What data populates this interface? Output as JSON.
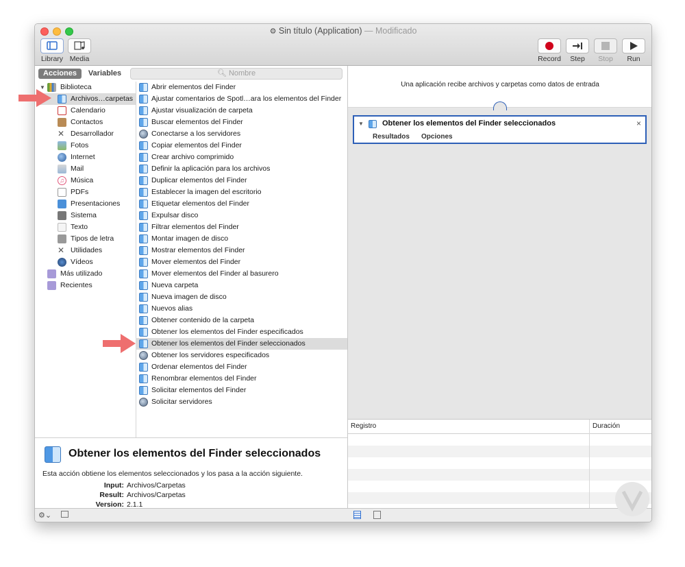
{
  "window": {
    "title": "Sin título (Application)",
    "title_suffix": "— Modificado"
  },
  "toolbar": {
    "library_label": "Library",
    "media_label": "Media",
    "record_label": "Record",
    "step_label": "Step",
    "stop_label": "Stop",
    "run_label": "Run"
  },
  "left": {
    "tab_actions": "Acciones",
    "tab_variables": "Variables",
    "search_placeholder": "Nombre",
    "library": [
      {
        "label": "Biblioteca",
        "icon": "library-icon"
      },
      {
        "label": "Archivos…carpetas",
        "icon": "finder-icon"
      },
      {
        "label": "Calendario",
        "icon": "calendar-icon"
      },
      {
        "label": "Contactos",
        "icon": "contacts-icon"
      },
      {
        "label": "Desarrollador",
        "icon": "developer-icon"
      },
      {
        "label": "Fotos",
        "icon": "photos-icon"
      },
      {
        "label": "Internet",
        "icon": "internet-icon"
      },
      {
        "label": "Mail",
        "icon": "mail-icon"
      },
      {
        "label": "Música",
        "icon": "music-icon"
      },
      {
        "label": "PDFs",
        "icon": "pdf-icon"
      },
      {
        "label": "Presentaciones",
        "icon": "presentation-icon"
      },
      {
        "label": "Sistema",
        "icon": "system-icon"
      },
      {
        "label": "Texto",
        "icon": "text-icon"
      },
      {
        "label": "Tipos de letra",
        "icon": "fonts-icon"
      },
      {
        "label": "Utilidades",
        "icon": "utilities-icon"
      },
      {
        "label": "Vídeos",
        "icon": "videos-icon"
      },
      {
        "label": "Más utilizado",
        "icon": "smart-folder-icon"
      },
      {
        "label": "Recientes",
        "icon": "smart-folder-icon"
      }
    ],
    "actions": [
      "Abrir elementos del Finder",
      "Ajustar comentarios de Spotl…ara los elementos del Finder",
      "Ajustar visualización de carpeta",
      "Buscar elementos del Finder",
      "Conectarse a los servidores",
      "Copiar elementos del Finder",
      "Crear archivo comprimido",
      "Definir la aplicación para los archivos",
      "Duplicar elementos del Finder",
      "Establecer la imagen del escritorio",
      "Etiquetar elementos del Finder",
      "Expulsar disco",
      "Filtrar elementos del Finder",
      "Montar imagen de disco",
      "Mostrar elementos del Finder",
      "Mover elementos del Finder",
      "Mover elementos del Finder al basurero",
      "Nueva carpeta",
      "Nueva imagen de disco",
      "Nuevos alias",
      "Obtener contenido de la carpeta",
      "Obtener los elementos del Finder especificados",
      "Obtener los elementos del Finder seleccionados",
      "Obtener los servidores especificados",
      "Ordenar elementos del Finder",
      "Renombrar elementos del Finder",
      "Solicitar elementos del Finder",
      "Solicitar servidores"
    ],
    "description": {
      "title": "Obtener los elementos del Finder seleccionados",
      "text": "Esta acción obtiene los elementos seleccionados y los pasa a la acción siguiente.",
      "input_key": "Input:",
      "input_val": "Archivos/Carpetas",
      "result_key": "Result:",
      "result_val": "Archivos/Carpetas",
      "version_key": "Version:",
      "version_val": "2.1.1"
    }
  },
  "workflow": {
    "input_text": "Una aplicación recibe archivos y carpetas como datos de entrada",
    "action_title": "Obtener los elementos del Finder seleccionados",
    "tab_results": "Resultados",
    "tab_options": "Opciones",
    "close_glyph": "×",
    "log_header": "Registro",
    "duration_header": "Duración"
  },
  "colors": {
    "accent": "#2d5fb7",
    "arrow": "#ee6f6f"
  }
}
